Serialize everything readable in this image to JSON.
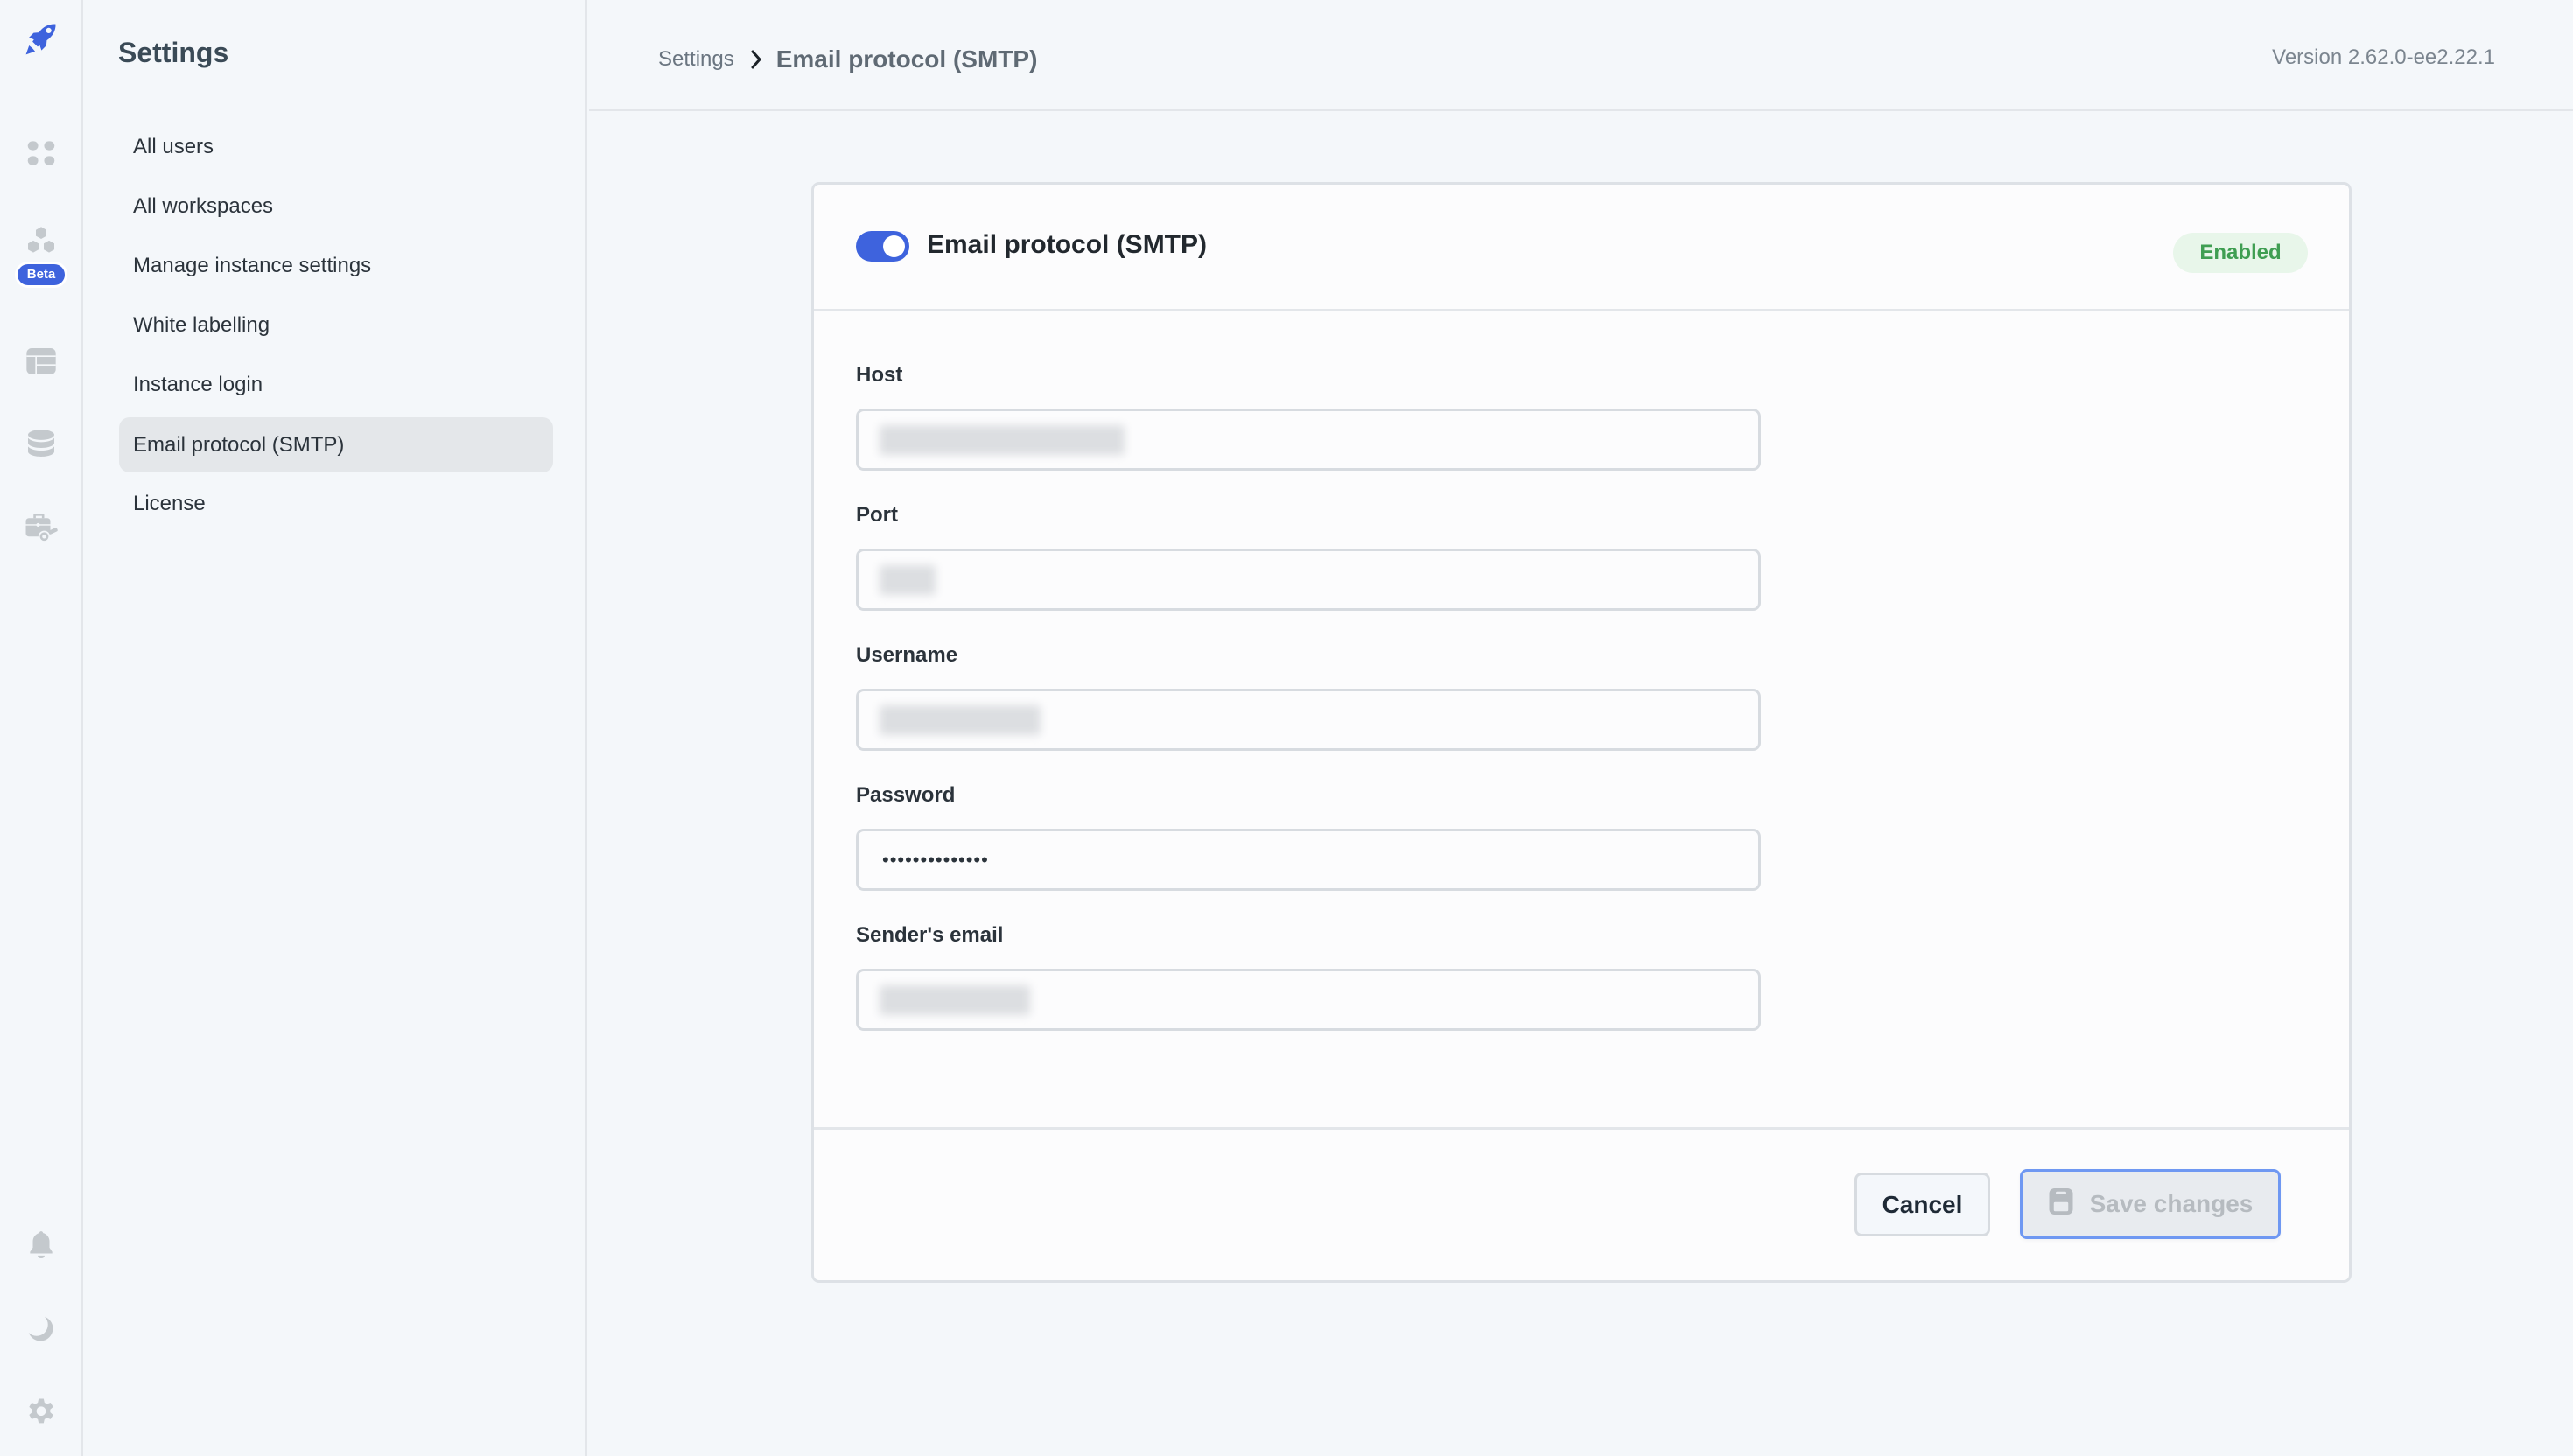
{
  "rail": {
    "logo_icon": "rocket-icon",
    "items": [
      {
        "icon": "apps-grid-icon",
        "label": ""
      },
      {
        "icon": "modules-hexagon-icon",
        "badge": "Beta"
      },
      {
        "icon": "table-layout-icon"
      },
      {
        "icon": "database-icon"
      },
      {
        "icon": "toolbox-key-icon"
      }
    ],
    "bottom": [
      {
        "icon": "bell-icon"
      },
      {
        "icon": "moon-icon"
      },
      {
        "icon": "gear-icon"
      }
    ]
  },
  "sidebar": {
    "title": "Settings",
    "items": [
      {
        "label": "All users",
        "active": false
      },
      {
        "label": "All workspaces",
        "active": false
      },
      {
        "label": "Manage instance settings",
        "active": false
      },
      {
        "label": "White labelling",
        "active": false
      },
      {
        "label": "Instance login",
        "active": false
      },
      {
        "label": "Email protocol (SMTP)",
        "active": true
      },
      {
        "label": "License",
        "active": false
      }
    ]
  },
  "header": {
    "breadcrumb": {
      "root": "Settings",
      "current": "Email protocol (SMTP)"
    },
    "version": "Version 2.62.0-ee2.22.1"
  },
  "card": {
    "title": "Email protocol (SMTP)",
    "toggle_on": true,
    "status_badge": "Enabled",
    "fields": [
      {
        "label": "Host",
        "value": "[redacted]",
        "redacted": true
      },
      {
        "label": "Port",
        "value": "[redacted]",
        "redacted": true
      },
      {
        "label": "Username",
        "value": "[redacted]",
        "redacted": true
      },
      {
        "label": "Password",
        "value": "••••••••••••••",
        "redacted": false
      },
      {
        "label": "Sender's email",
        "value": "[redacted]",
        "redacted": true
      }
    ],
    "cancel_label": "Cancel",
    "save_label": "Save changes",
    "save_disabled": true
  },
  "colors": {
    "accent": "#3e63dd",
    "success_text": "#3f9e52",
    "success_bg": "#e8f6ea",
    "background": "#f4f7fa"
  }
}
